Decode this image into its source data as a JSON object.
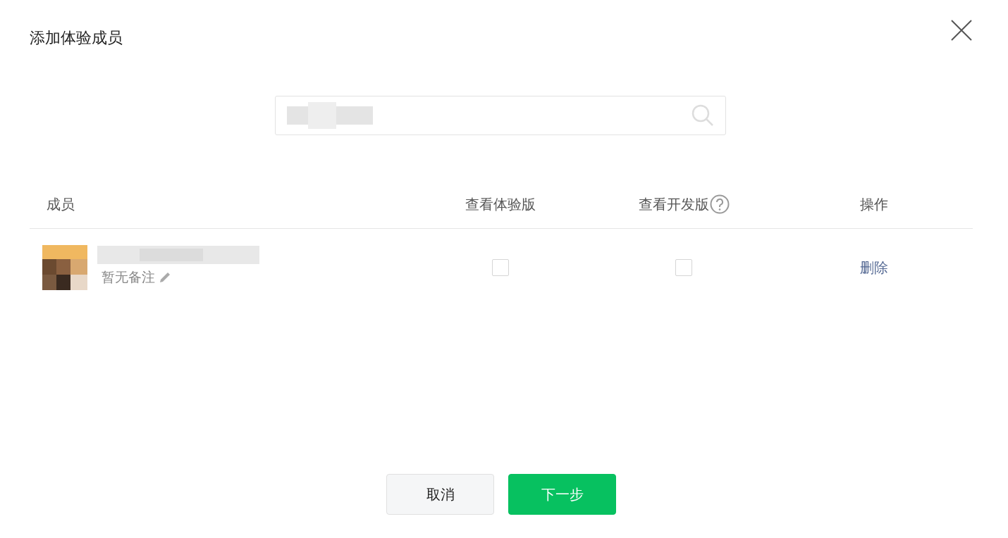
{
  "dialog": {
    "title": "添加体验成员"
  },
  "table": {
    "columns": [
      {
        "label": "成员",
        "help": false
      },
      {
        "label": "查看体验版",
        "help": false
      },
      {
        "label": "查看开发版",
        "help": true
      },
      {
        "label": "操作",
        "help": false
      }
    ],
    "rows": [
      {
        "note": "暂无备注",
        "view_trial": {
          "checked": false
        },
        "view_dev": {
          "checked": false
        },
        "action": "删除"
      }
    ]
  },
  "buttons": [
    {
      "label": "取消",
      "kind": "secondary"
    },
    {
      "label": "下一步",
      "kind": "primary"
    }
  ]
}
